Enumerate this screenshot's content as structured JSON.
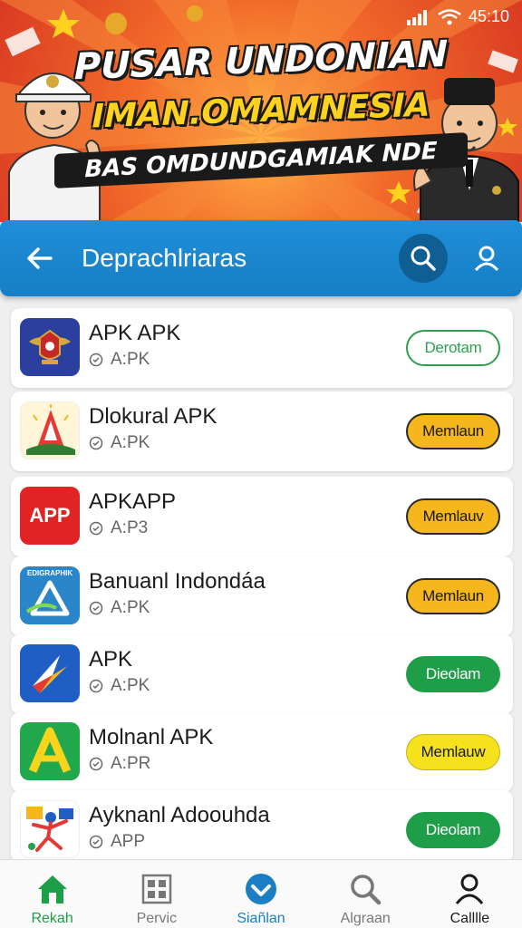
{
  "status_bar": {
    "time": "45:10"
  },
  "banner": {
    "line1": "PUSAR UNDONIAN",
    "line2": "IMAN.OMAMNESIA",
    "line3": "BAS OMDUNDGAMIAK NDE"
  },
  "app_bar": {
    "title": "Deprachlriaras"
  },
  "apps": [
    {
      "name": "APK APK",
      "sub": "A:PK",
      "action": "Derotam",
      "style": "outline",
      "icon": "crest-icon"
    },
    {
      "name": "Dlokural APK",
      "sub": "A:PK",
      "action": "Memlaun",
      "style": "yellow",
      "icon": "monument-icon"
    },
    {
      "name": "APKAPP",
      "sub": "A:P3",
      "action": "Memlauv",
      "style": "yellow",
      "icon": "app-text-icon",
      "icon_text": "APP"
    },
    {
      "name": "Banuanl Indondáa",
      "sub": "A:PK",
      "action": "Memlaun",
      "style": "yellow",
      "icon": "map-icon",
      "icon_text": "EDIGRAPHIK"
    },
    {
      "name": "APK",
      "sub": "A:PK",
      "action": "Dieolam",
      "style": "green",
      "icon": "arrow-logo-icon"
    },
    {
      "name": "Molnanl APK",
      "sub": "A:PR",
      "action": "Memlauw",
      "style": "yellow2",
      "icon": "letter-a-icon"
    },
    {
      "name": "Ayknanl Adoouhda",
      "sub": "APP",
      "action": "Dieolam",
      "style": "green",
      "icon": "figure-icon"
    }
  ],
  "bottom_nav": [
    {
      "label": "Rekah",
      "icon": "home-icon",
      "color": "#1f9e4a"
    },
    {
      "label": "Pervic",
      "icon": "grid-icon",
      "color": "#777777"
    },
    {
      "label": "Siañlan",
      "icon": "check-badge-icon",
      "color": "#1a7fc4"
    },
    {
      "label": "Algraan",
      "icon": "search-icon",
      "color": "#777777"
    },
    {
      "label": "Calllle",
      "icon": "profile-icon",
      "color": "#1a1a1a"
    }
  ],
  "colors": {
    "accent": "#1f8fd9",
    "green": "#1f9e4a",
    "yellow": "#f6b71c"
  }
}
